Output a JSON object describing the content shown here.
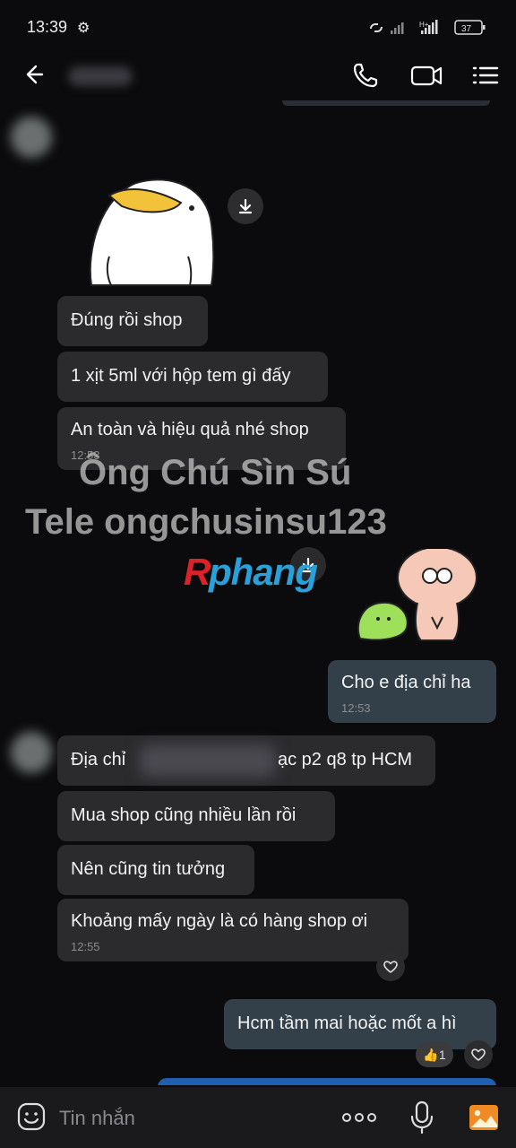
{
  "status_bar": {
    "time": "13:39",
    "network": "H+",
    "battery": "37"
  },
  "header": {
    "icons": [
      "back-arrow-icon",
      "phone-icon",
      "video-call-icon",
      "menu-list-icon"
    ]
  },
  "chat": {
    "messages": [
      {
        "id": "m1",
        "direction": "incoming",
        "text": "Đúng rồi shop"
      },
      {
        "id": "m2",
        "direction": "incoming",
        "text": "1 xịt 5ml với hộp tem gì đấy"
      },
      {
        "id": "m3",
        "direction": "incoming",
        "text": "An toàn và hiệu quả nhé shop",
        "time": "12:53"
      },
      {
        "id": "m4",
        "direction": "outgoing",
        "text": "Cho e địa chỉ ha",
        "time": "12:53"
      },
      {
        "id": "m5",
        "direction": "incoming",
        "text_prefix": "Địa chỉ",
        "text_suffix": "ạc p2 q8 tp HCM"
      },
      {
        "id": "m6",
        "direction": "incoming",
        "text": "Mua shop cũng nhiều lần rồi"
      },
      {
        "id": "m7",
        "direction": "incoming",
        "text": "Nên cũng tin tưởng"
      },
      {
        "id": "m8",
        "direction": "incoming",
        "text": "Khoảng mấy ngày là có hàng shop ơi",
        "time": "12:55"
      },
      {
        "id": "m9",
        "direction": "outgoing",
        "text": "Hcm tầm mai hoặc mốt a hì",
        "reaction_count": "1"
      }
    ]
  },
  "watermark": {
    "line1": "Ông Chú Sìn Sú",
    "line2": "Tele ongchusinsu123",
    "logo": "Rphang"
  },
  "composer": {
    "placeholder": "Tin nhắn"
  },
  "colors": {
    "background": "#0b0b0d",
    "incoming_bubble": "#2b2b2e",
    "outgoing_bubble": "#33404a",
    "logo_red": "#d8232a",
    "logo_blue": "#2aa0d8",
    "gallery_orange": "#f08a24"
  }
}
